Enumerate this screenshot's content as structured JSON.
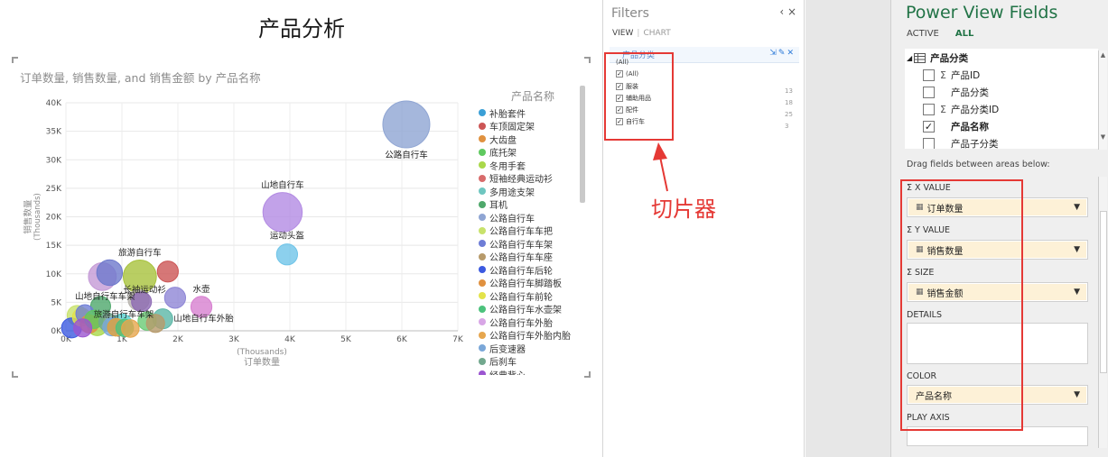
{
  "canvas": {
    "title": "产品分析",
    "chart_subtitle": "订单数量, 销售数量, and 销售金额 by 产品名称"
  },
  "chart_data": {
    "type": "scatter",
    "xlabel": "订单数量",
    "xlabel_unit": "(Thousands)",
    "ylabel": "销售数量",
    "ylabel_unit": "(Thousands)",
    "xlim": [
      0,
      7000
    ],
    "ylim": [
      0,
      40000
    ],
    "x_ticks": [
      "0K",
      "1K",
      "2K",
      "3K",
      "4K",
      "5K",
      "6K",
      "7K"
    ],
    "y_ticks": [
      "0K",
      "5K",
      "10K",
      "15K",
      "20K",
      "25K",
      "30K",
      "35K",
      "40K"
    ],
    "grid": true,
    "legend_title": "产品名称",
    "legend_position": "right",
    "points": [
      {
        "name": "公路自行车",
        "x": 6080,
        "y": 36200,
        "size": 100,
        "color": "#8fa5d3",
        "label": "公路自行车"
      },
      {
        "name": "山地自行车",
        "x": 3870,
        "y": 20800,
        "size": 70,
        "color": "#b38be3",
        "label": "山地自行车"
      },
      {
        "name": "运动头盔",
        "x": 3950,
        "y": 13400,
        "size": 20,
        "color": "#6fc4e8",
        "label": "运动头盔"
      },
      {
        "name": "旅游自行车",
        "x": 1320,
        "y": 9500,
        "size": 50,
        "color": "#a7c23c",
        "label": "旅游自行车"
      },
      {
        "name": "车顶固定架",
        "x": 1820,
        "y": 10400,
        "size": 20,
        "color": "#cc5555",
        "label": ""
      },
      {
        "name": "多用途支架",
        "x": 780,
        "y": 10200,
        "size": 30,
        "color": "#6e79cc",
        "label": ""
      },
      {
        "name": "补胎套件",
        "x": 650,
        "y": 9500,
        "size": 35,
        "color": "#c49ad6",
        "label": ""
      },
      {
        "name": "短袖经典运动衫",
        "x": 1950,
        "y": 5800,
        "size": 20,
        "color": "#8e86d6",
        "label": "长袖运动衫"
      },
      {
        "name": "水壶",
        "x": 2420,
        "y": 4200,
        "size": 20,
        "color": "#d77fd0",
        "label": "水壶"
      },
      {
        "name": "山地自行车车架",
        "x": 1300,
        "y": 5400,
        "size": 20,
        "color": "#b7b3ad",
        "label": "山地自行车车架"
      },
      {
        "name": "长袖运动衫",
        "x": 1350,
        "y": 5100,
        "size": 18,
        "color": "#8c69b3",
        "label": ""
      },
      {
        "name": "山地自行车外胎",
        "x": 1730,
        "y": 2100,
        "size": 18,
        "color": "#5bb6a6",
        "label": "山地自行车外胎"
      },
      {
        "name": "公路自行车外胎",
        "x": 1450,
        "y": 1700,
        "size": 15,
        "color": "#6acb74",
        "label": ""
      },
      {
        "name": "旅游自行车车架",
        "x": 1000,
        "y": 1100,
        "size": 20,
        "color": "#59d0cf",
        "label": "旅游自行车车架"
      },
      {
        "name": "耳机",
        "x": 620,
        "y": 4300,
        "size": 18,
        "color": "#4ea86b",
        "label": ""
      },
      {
        "name": "公路自行车车把",
        "x": 200,
        "y": 2700,
        "size": 18,
        "color": "#c8e26b",
        "label": ""
      },
      {
        "name": "公路自行车前轮",
        "x": 280,
        "y": 2400,
        "size": 15,
        "color": "#e3e34a",
        "label": ""
      },
      {
        "name": "公路自行车车架",
        "x": 340,
        "y": 3000,
        "size": 15,
        "color": "#6e7dd6",
        "label": ""
      },
      {
        "name": "公路自行车后轮",
        "x": 100,
        "y": 500,
        "size": 18,
        "color": "#3c5ae0",
        "label": ""
      },
      {
        "name": "公路自行车脚踏板",
        "x": 420,
        "y": 1200,
        "size": 15,
        "color": "#e0913f",
        "label": ""
      },
      {
        "name": "冬用手套",
        "x": 560,
        "y": 900,
        "size": 18,
        "color": "#a9d84a",
        "label": ""
      },
      {
        "name": "底托架",
        "x": 500,
        "y": 2000,
        "size": 15,
        "color": "#5fc95f",
        "label": ""
      },
      {
        "name": "后刹车",
        "x": 750,
        "y": 1500,
        "size": 15,
        "color": "#72a88e",
        "label": ""
      },
      {
        "name": "后变速器",
        "x": 820,
        "y": 700,
        "size": 15,
        "color": "#7aa7d8",
        "label": ""
      },
      {
        "name": "大齿盘",
        "x": 900,
        "y": 600,
        "size": 14,
        "color": "#e0a13c",
        "label": ""
      },
      {
        "name": "公路自行车水壶架",
        "x": 1050,
        "y": 500,
        "size": 14,
        "color": "#4cc27c",
        "label": ""
      },
      {
        "name": "公路自行车外胎内胎",
        "x": 1150,
        "y": 400,
        "size": 14,
        "color": "#e6a64e",
        "label": ""
      },
      {
        "name": "公路自行车车座",
        "x": 1600,
        "y": 1300,
        "size": 15,
        "color": "#b79a6a",
        "label": ""
      },
      {
        "name": "经典背心",
        "x": 300,
        "y": 500,
        "size": 15,
        "color": "#9b55d0",
        "label": ""
      }
    ]
  },
  "legend": {
    "items": [
      {
        "label": "补胎套件",
        "color": "#3a9fd6"
      },
      {
        "label": "车顶固定架",
        "color": "#cc5555"
      },
      {
        "label": "大齿盘",
        "color": "#e0913f"
      },
      {
        "label": "底托架",
        "color": "#5fc95f"
      },
      {
        "label": "冬用手套",
        "color": "#a9d84a"
      },
      {
        "label": "短袖经典运动衫",
        "color": "#d86b6b"
      },
      {
        "label": "多用途支架",
        "color": "#6ec6c0"
      },
      {
        "label": "耳机",
        "color": "#4ea86b"
      },
      {
        "label": "公路自行车",
        "color": "#8fa5d3"
      },
      {
        "label": "公路自行车车把",
        "color": "#c8e26b"
      },
      {
        "label": "公路自行车车架",
        "color": "#6e7dd6"
      },
      {
        "label": "公路自行车车座",
        "color": "#b79a6a"
      },
      {
        "label": "公路自行车后轮",
        "color": "#3c5ae0"
      },
      {
        "label": "公路自行车脚踏板",
        "color": "#e0913f"
      },
      {
        "label": "公路自行车前轮",
        "color": "#e3e34a"
      },
      {
        "label": "公路自行车水壶架",
        "color": "#4cc27c"
      },
      {
        "label": "公路自行车外胎",
        "color": "#d8a6e6"
      },
      {
        "label": "公路自行车外胎内胎",
        "color": "#e6a64e"
      },
      {
        "label": "后变速器",
        "color": "#7aa7d8"
      },
      {
        "label": "后刹车",
        "color": "#72a88e"
      },
      {
        "label": "经典背心",
        "color": "#9b55d0"
      }
    ]
  },
  "filters": {
    "title": "Filters",
    "controls": "‹ ×",
    "tab_view": "VIEW",
    "tab_chart": "CHART",
    "field_title": "产品分类",
    "field_icons": "⇲✎✕",
    "items": [
      {
        "label": "(All)",
        "checked": false,
        "count": ""
      },
      {
        "label": "(All)",
        "checked": true,
        "count": ""
      },
      {
        "label": "服装",
        "checked": true,
        "count": "13"
      },
      {
        "label": "辅助用品",
        "checked": true,
        "count": "18"
      },
      {
        "label": "配件",
        "checked": true,
        "count": "25"
      },
      {
        "label": "自行车",
        "checked": true,
        "count": "3"
      }
    ],
    "annotation": "切片器"
  },
  "fields": {
    "title": "Power View Fields",
    "tab_active": "ACTIVE",
    "tab_all": "ALL",
    "table_name": "产品分类",
    "field_items": [
      {
        "label": "产品ID",
        "sigma": true,
        "checked": false,
        "bold": false
      },
      {
        "label": "产品分类",
        "sigma": false,
        "checked": false,
        "bold": false
      },
      {
        "label": "产品分类ID",
        "sigma": true,
        "checked": false,
        "bold": false
      },
      {
        "label": "产品名称",
        "sigma": false,
        "checked": true,
        "bold": true
      },
      {
        "label": "产品子分类",
        "sigma": false,
        "checked": false,
        "bold": false
      }
    ],
    "drag_hint": "Drag fields between areas below:",
    "x_value_label": "X VALUE",
    "x_value_field": "订单数量",
    "y_value_label": "Y VALUE",
    "y_value_field": "销售数量",
    "size_label": "SIZE",
    "size_field": "销售金额",
    "details_label": "DETAILS",
    "color_label": "COLOR",
    "color_field": "产品名称",
    "play_axis_label": "PLAY AXIS"
  }
}
